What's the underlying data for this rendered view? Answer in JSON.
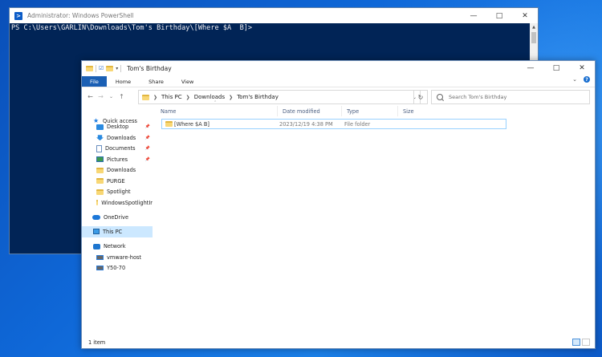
{
  "colors": {
    "desktop_blue": "#0f68d8",
    "powershell_bg": "#012456",
    "powershell_text": "#eeedf0",
    "ribbon_file_tab": "#1a5fb4",
    "selection": "#cce8ff",
    "folder": "#f8d775"
  },
  "powershell": {
    "title": "Administrator: Windows PowerShell",
    "prompt_line": "PS C:\\Users\\GARLIN\\Downloads\\Tom's Birthday\\[Where $A  B]>"
  },
  "explorer": {
    "title": "Tom's Birthday",
    "ribbon_tabs": [
      "File",
      "Home",
      "Share",
      "View"
    ],
    "breadcrumb": [
      "This PC",
      "Downloads",
      "Tom's Birthday"
    ],
    "search_placeholder": "Search Tom's Birthday",
    "nav": {
      "quick_access": "Quick access",
      "items": [
        {
          "label": "Desktop",
          "icon": "desktop-icon"
        },
        {
          "label": "Downloads",
          "icon": "download-icon"
        },
        {
          "label": "Documents",
          "icon": "documents-icon"
        },
        {
          "label": "Pictures",
          "icon": "pictures-icon"
        },
        {
          "label": "Downloads",
          "icon": "folder-icon"
        },
        {
          "label": "PURGE",
          "icon": "folder-icon"
        },
        {
          "label": "Spotlight",
          "icon": "folder-icon"
        },
        {
          "label": "WindowsSpotlightIr",
          "icon": "folder-icon"
        }
      ],
      "onedrive": "OneDrive",
      "this_pc": "This PC",
      "network": "Network",
      "network_items": [
        "vmware-host",
        "Y50-70"
      ]
    },
    "columns": {
      "name": "Name",
      "date_modified": "Date modified",
      "type": "Type",
      "size": "Size"
    },
    "files": [
      {
        "name": "[Where $A  B]",
        "date_modified": "2023/12/19 4:38 PM",
        "type": "File folder",
        "size": ""
      }
    ],
    "status": "1 item"
  }
}
